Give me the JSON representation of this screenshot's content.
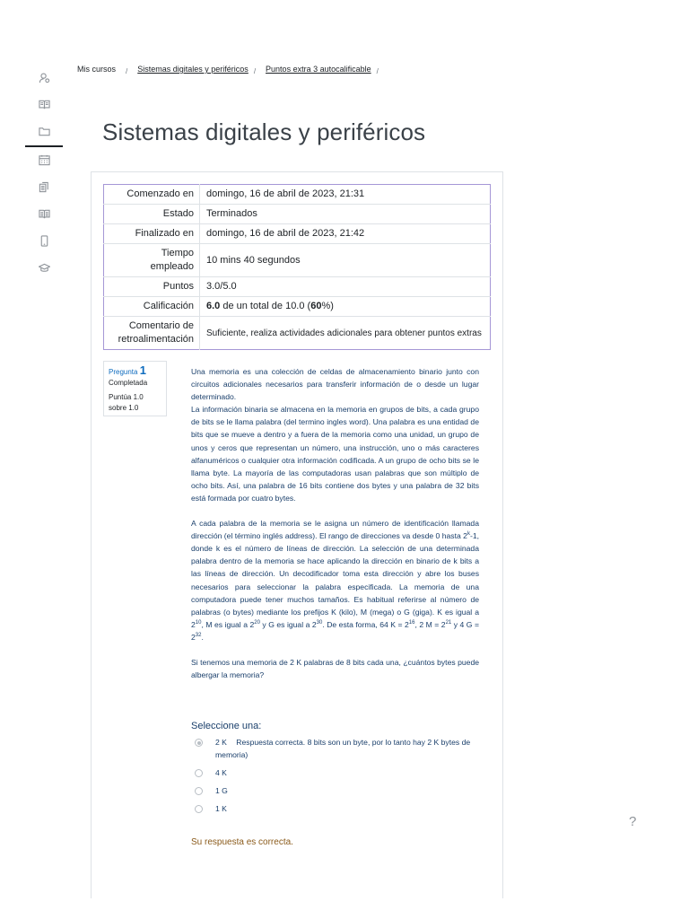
{
  "breadcrumb": {
    "items": [
      "Mis cursos",
      "Sistemas digitales y periféricos",
      "Puntos extra 3 autocalificable"
    ],
    "separator": "/"
  },
  "page_title": "Sistemas digitales y periféricos",
  "rail_icons": [
    "user-icon",
    "book-icon",
    "folder-icon",
    "calendar-icon",
    "copy-icon",
    "library-icon",
    "phone-icon",
    "graduation-cap-icon"
  ],
  "summary": {
    "started_label": "Comenzado en",
    "started_value": "domingo, 16 de abril de 2023, 21:31",
    "state_label": "Estado",
    "state_value": "Terminados",
    "finished_label": "Finalizado en",
    "finished_value": "domingo, 16 de abril de 2023, 21:42",
    "time_label_1": "Tiempo",
    "time_label_2": "empleado",
    "time_value": "10 mins 40 segundos",
    "points_label": "Puntos",
    "points_value": "3.0/5.0",
    "grade_label": "Calificación",
    "grade_score": "6.0",
    "grade_middle": " de un total de 10.0 (",
    "grade_percent": "60",
    "grade_end": "%)",
    "feedback_label_1": "Comentario de",
    "feedback_label_2": "retroalimentación",
    "feedback_value": " Suficiente, realiza actividades adicionales para obtener puntos extras"
  },
  "question_info": {
    "label": "Pregunta",
    "number": "1",
    "status": "Completada",
    "score_1": "Puntúa 1.0",
    "score_2": "sobre 1.0"
  },
  "question": {
    "p1": "Una memoria es una colección de celdas de almacenamiento binario junto con circuitos adicionales necesarios para transferir información de o desde un lugar determinado.",
    "p2": "La información binaria se almacena en la memoria en grupos de bits, a cada grupo de bits se le llama palabra (del termino ingles word). Una palabra es una entidad de bits que se mueve a dentro y a fuera de la memoria como una unidad, un grupo de unos y ceros que representan un número, una instrucción, uno o más caracteres alfanuméricos o cualquier otra información codificada. A un grupo de ocho bits se le llama byte. La mayoría de las computadoras usan palabras que son múltiplo de ocho bits. Así, una palabra de 16 bits contiene dos bytes y una palabra de 32 bits está formada por cuatro bytes.",
    "p3a": "A cada palabra de la memoria se le asigna un número de identificación llamada dirección (el término inglés address). El rango de direcciones va desde 0 hasta 2",
    "p3a_sup": "k",
    "p3b": "-1, donde k es el número de líneas de dirección. La selección de una determinada palabra dentro de la memoria se hace aplicando la dirección en binario de k bits a las líneas de dirección. Un decodificador toma esta dirección y abre los buses necesarios para seleccionar la palabra especificada. La memoria de una computadora puede tener muchos tamaños. Es habitual referirse al número de palabras (o bytes) mediante los prefijos K (kilo), M (mega) o G (giga). K es igual a 2",
    "sup_10": "10",
    "p3c": ", M es igual a 2",
    "sup_20": "20",
    "p3d": " y G es igual a 2",
    "sup_30": "30",
    "p3e": ". De esta forma, 64 K = 2",
    "sup_16": "16",
    "p3f": ", 2 M = 2",
    "sup_21": "21",
    "p3g": " y 4 G = 2",
    "sup_32": "32",
    "p3h": ".",
    "p4": "Si tenemos una memoria de 2 K palabras de 8 bits cada una, ¿cuántos bytes puede albergar la memoria?"
  },
  "select_label": "Seleccione una:",
  "answers": [
    {
      "option": "2 K",
      "text": "Respuesta correcta. 8 bits son un byte, por lo tanto hay 2 K bytes de memoria)"
    },
    {
      "option": "4 K",
      "text": ""
    },
    {
      "option": "1 G",
      "text": ""
    },
    {
      "option": "1 K",
      "text": ""
    }
  ],
  "feedback": "Su respuesta es correcta.",
  "help_label": "?"
}
